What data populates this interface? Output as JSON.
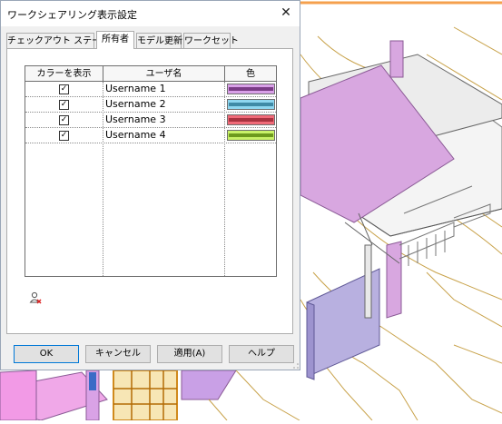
{
  "dialog": {
    "title": "ワークシェアリング表示設定",
    "close_icon": "close-icon"
  },
  "tabs": [
    {
      "label": "チェックアウト ステータス",
      "active": false
    },
    {
      "label": "所有者",
      "active": true
    },
    {
      "label": "モデル更新",
      "active": false
    },
    {
      "label": "ワークセット",
      "active": false
    }
  ],
  "table": {
    "headers": [
      "カラーを表示",
      "ユーザ名",
      "色"
    ],
    "rows": [
      {
        "checked": true,
        "check_glyph": "✓",
        "username": "Username 1",
        "color": "#d9a0e8",
        "stripe": "#7a3b86"
      },
      {
        "checked": true,
        "check_glyph": "✓",
        "username": "Username 2",
        "color": "#8fd6ef",
        "stripe": "#3f8aa6"
      },
      {
        "checked": true,
        "check_glyph": "✓",
        "username": "Username 3",
        "color": "#f06a78",
        "stripe": "#a8323f"
      },
      {
        "checked": true,
        "check_glyph": "✓",
        "username": "Username 4",
        "color": "#c9f268",
        "stripe": "#6d9a1d"
      }
    ]
  },
  "icons": {
    "remove_user": "remove-user-icon"
  },
  "buttons": {
    "ok": "OK",
    "cancel": "キャンセル",
    "apply": "適用(A)",
    "help": "ヘルプ"
  },
  "colors": {
    "accent": "#0078d7",
    "model_magenta": "#d8a7e0",
    "model_purple": "#b8b0e0",
    "model_orange": "#f5a04d"
  }
}
